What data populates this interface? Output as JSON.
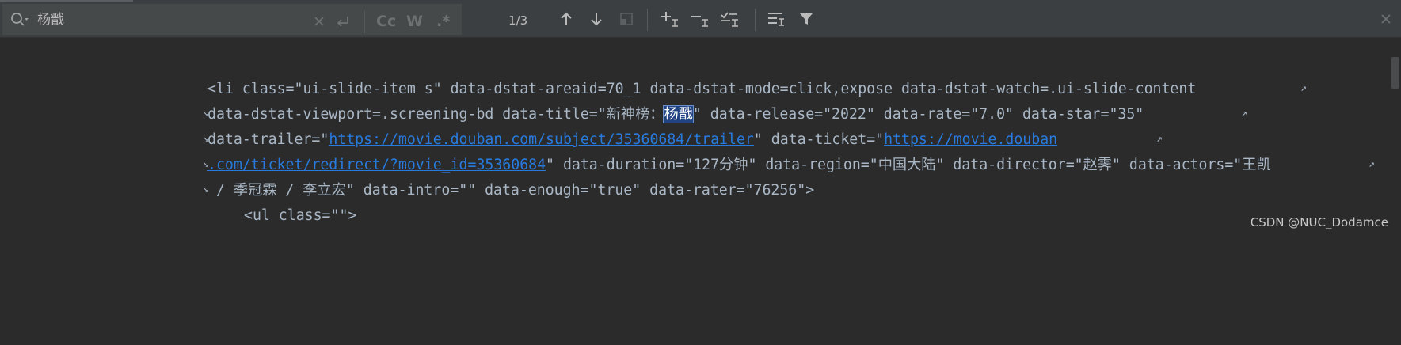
{
  "search": {
    "query": "杨戬",
    "match_counter": "1/3"
  },
  "toolbar": {
    "match_case_label": "Cc",
    "whole_words_label": "W",
    "regex_label": ".*"
  },
  "code": {
    "lines": [
      {
        "segments": [
          {
            "text": "<li class=\"ui-slide-item s\" data-dstat-areaid=70_1 data-dstat-mode=click,expose data-dstat-watch=.ui-slide-content",
            "kind": "text"
          }
        ]
      },
      {
        "segments": [
          {
            "text": "data-dstat-viewport=.screening-bd data-title=\"",
            "kind": "text"
          },
          {
            "text": "新神榜：",
            "kind": "cjk"
          },
          {
            "text": "杨戬",
            "kind": "highlight"
          },
          {
            "text": "\" data-release=\"2022\" data-rate=\"7.0\" data-star=\"35\"",
            "kind": "text"
          }
        ]
      },
      {
        "segments": [
          {
            "text": "data-trailer=\"",
            "kind": "text"
          },
          {
            "text": "https://movie.douban.com/subject/35360684/trailer",
            "kind": "link"
          },
          {
            "text": "\" data-ticket=\"",
            "kind": "text"
          },
          {
            "text": "https://movie.douban",
            "kind": "link"
          }
        ]
      },
      {
        "segments": [
          {
            "text": ".com/ticket/redirect/?movie_id=35360684",
            "kind": "link"
          },
          {
            "text": "\" data-duration=\"127",
            "kind": "text"
          },
          {
            "text": "分钟",
            "kind": "cjk"
          },
          {
            "text": "\" data-region=\"",
            "kind": "text"
          },
          {
            "text": "中国大陆",
            "kind": "cjk"
          },
          {
            "text": "\" data-director=\"",
            "kind": "text"
          },
          {
            "text": "赵霁",
            "kind": "cjk"
          },
          {
            "text": "\" data-actors=\"",
            "kind": "text"
          },
          {
            "text": "王凯",
            "kind": "cjk"
          }
        ]
      },
      {
        "segments": [
          {
            "text": " / ",
            "kind": "text"
          },
          {
            "text": "季冠霖",
            "kind": "cjk"
          },
          {
            "text": " / ",
            "kind": "text"
          },
          {
            "text": "李立宏",
            "kind": "cjk"
          },
          {
            "text": "\" data-intro=\"\" data-enough=\"true\" data-rater=\"76256\">",
            "kind": "text"
          }
        ]
      },
      {
        "segments": [
          {
            "text": "<ul class=\"\">",
            "kind": "text"
          }
        ]
      }
    ]
  },
  "watermark": "CSDN @NUC_Dodamce"
}
